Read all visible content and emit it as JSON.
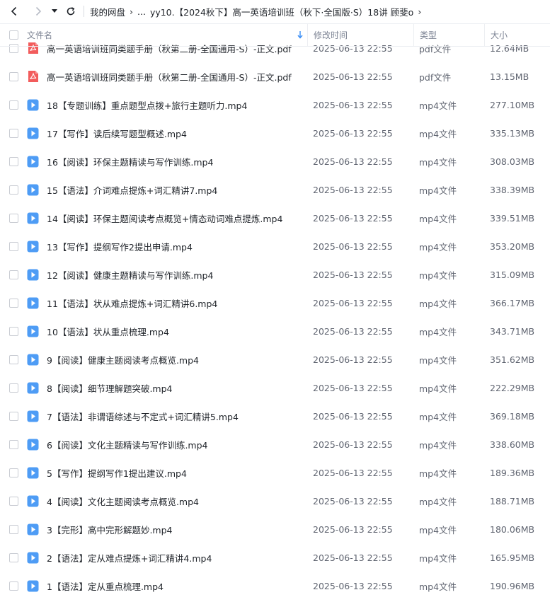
{
  "toolbar": {
    "crumb_root": "我的网盘",
    "crumb_ellipsis": "...",
    "crumb_current": "yy10.【2024秋下】高一英语培训班（秋下·全国版·S）18讲 顾斐o"
  },
  "columns": {
    "name": "文件名",
    "time": "修改时间",
    "type": "类型",
    "size": "大小"
  },
  "colors": {
    "pdf": "#f25c5c",
    "video": "#4e9cf5",
    "sort": "#3a8ef6"
  },
  "files": [
    {
      "icon": "pdf-icon",
      "name": "高一英语培训班同类题手册（秋第二册-全国通用-S）-正文.pdf",
      "time": "2025-06-13 22:55",
      "type": "pdf文件",
      "size": "12.64MB"
    },
    {
      "icon": "pdf-icon",
      "name": "高一英语培训班同类题手册（秋第二册-全国通用-S）-正文.pdf",
      "time": "2025-06-13 22:55",
      "type": "pdf文件",
      "size": "13.15MB"
    },
    {
      "icon": "video-icon",
      "name": "18【专题训练】重点题型点拨+旅行主题听力.mp4",
      "time": "2025-06-13 22:55",
      "type": "mp4文件",
      "size": "277.10MB"
    },
    {
      "icon": "video-icon",
      "name": "17【写作】读后续写题型概述.mp4",
      "time": "2025-06-13 22:55",
      "type": "mp4文件",
      "size": "335.13MB"
    },
    {
      "icon": "video-icon",
      "name": "16【阅读】环保主题精读与写作训练.mp4",
      "time": "2025-06-13 22:55",
      "type": "mp4文件",
      "size": "308.03MB"
    },
    {
      "icon": "video-icon",
      "name": "15【语法】介词难点提炼+词汇精讲7.mp4",
      "time": "2025-06-13 22:55",
      "type": "mp4文件",
      "size": "338.39MB"
    },
    {
      "icon": "video-icon",
      "name": "14【阅读】环保主题阅读考点概览+情态动词难点提炼.mp4",
      "time": "2025-06-13 22:55",
      "type": "mp4文件",
      "size": "339.51MB"
    },
    {
      "icon": "video-icon",
      "name": "13【写作】提纲写作2提出申请.mp4",
      "time": "2025-06-13 22:55",
      "type": "mp4文件",
      "size": "353.20MB"
    },
    {
      "icon": "video-icon",
      "name": "12【阅读】健康主题精读与写作训练.mp4",
      "time": "2025-06-13 22:55",
      "type": "mp4文件",
      "size": "315.09MB"
    },
    {
      "icon": "video-icon",
      "name": "11【语法】状从难点提炼+词汇精讲6.mp4",
      "time": "2025-06-13 22:55",
      "type": "mp4文件",
      "size": "366.17MB"
    },
    {
      "icon": "video-icon",
      "name": "10【语法】状从重点梳理.mp4",
      "time": "2025-06-13 22:55",
      "type": "mp4文件",
      "size": "343.71MB"
    },
    {
      "icon": "video-icon",
      "name": "9【阅读】健康主题阅读考点概览.mp4",
      "time": "2025-06-13 22:55",
      "type": "mp4文件",
      "size": "351.62MB"
    },
    {
      "icon": "video-icon",
      "name": "8【阅读】细节理解题突破.mp4",
      "time": "2025-06-13 22:55",
      "type": "mp4文件",
      "size": "222.29MB"
    },
    {
      "icon": "video-icon",
      "name": "7【语法】非谓语综述与不定式+词汇精讲5.mp4",
      "time": "2025-06-13 22:55",
      "type": "mp4文件",
      "size": "369.18MB"
    },
    {
      "icon": "video-icon",
      "name": "6【阅读】文化主题精读与写作训练.mp4",
      "time": "2025-06-13 22:55",
      "type": "mp4文件",
      "size": "338.60MB"
    },
    {
      "icon": "video-icon",
      "name": "5【写作】提纲写作1提出建议.mp4",
      "time": "2025-06-13 22:55",
      "type": "mp4文件",
      "size": "189.36MB"
    },
    {
      "icon": "video-icon",
      "name": "4【阅读】文化主题阅读考点概览.mp4",
      "time": "2025-06-13 22:55",
      "type": "mp4文件",
      "size": "188.71MB"
    },
    {
      "icon": "video-icon",
      "name": "3【完形】高中完形解题妙.mp4",
      "time": "2025-06-13 22:55",
      "type": "mp4文件",
      "size": "180.06MB"
    },
    {
      "icon": "video-icon",
      "name": "2【语法】定从难点提炼+词汇精讲4.mp4",
      "time": "2025-06-13 22:55",
      "type": "mp4文件",
      "size": "165.95MB"
    },
    {
      "icon": "video-icon",
      "name": "1【语法】定从重点梳理.mp4",
      "time": "2025-06-13 22:55",
      "type": "mp4文件",
      "size": "190.96MB"
    }
  ]
}
